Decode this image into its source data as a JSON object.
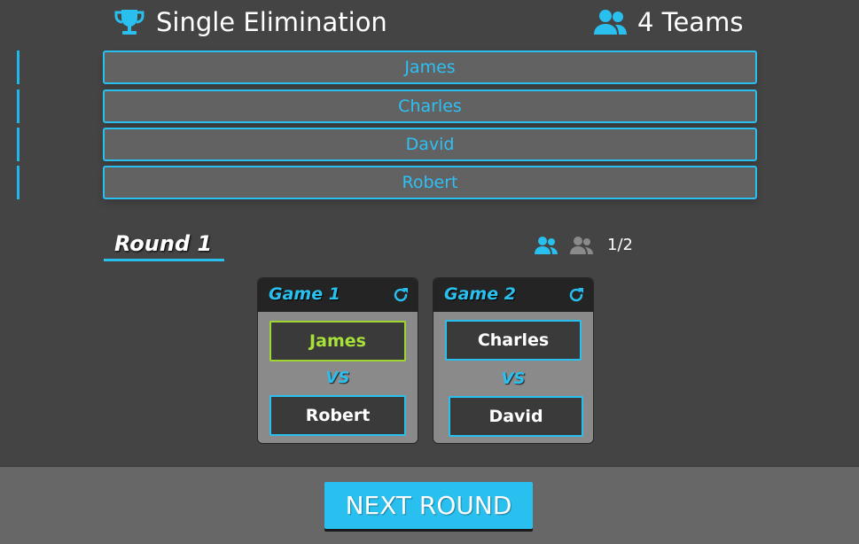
{
  "header": {
    "title": "Single Elimination",
    "teams_count": "4 Teams"
  },
  "teams": [
    {
      "name": "James"
    },
    {
      "name": "Charles"
    },
    {
      "name": "David"
    },
    {
      "name": "Robert"
    }
  ],
  "round": {
    "title": "Round 1",
    "progress": "1/2"
  },
  "games": [
    {
      "title": "Game 1",
      "player1": "James",
      "vs": "VS",
      "player2": "Robert",
      "winner": "James"
    },
    {
      "title": "Game 2",
      "player1": "Charles",
      "vs": "VS",
      "player2": "David",
      "winner": ""
    }
  ],
  "footer": {
    "next_label": "NEXT ROUND"
  },
  "colors": {
    "accent": "#29c0ef",
    "background": "#444444",
    "footer": "#676767",
    "winner": "#a8e03a",
    "card_head": "#242424"
  },
  "icons": {
    "title": "trophy-icon",
    "teams": "users-icon",
    "game_reset": "refresh-icon",
    "round_status": [
      "users-icon",
      "users-icon"
    ]
  }
}
